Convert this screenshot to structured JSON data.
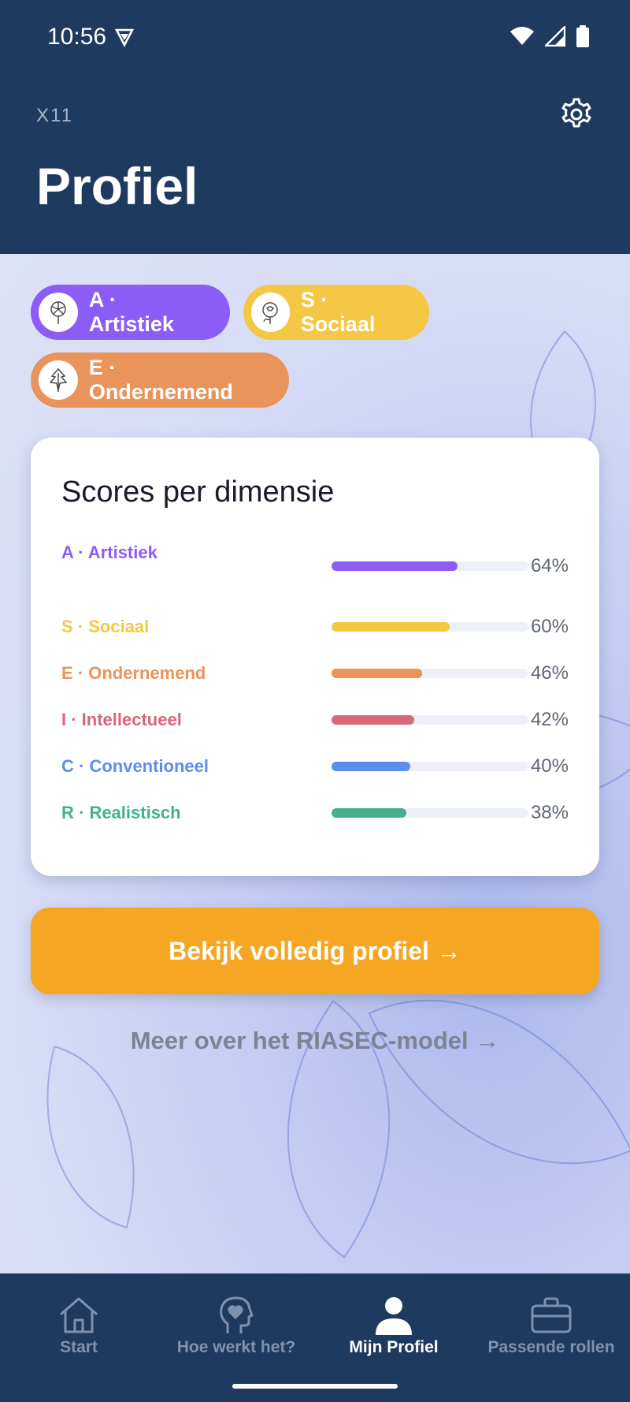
{
  "status_bar": {
    "time": "10:56"
  },
  "header": {
    "user_code": "X11",
    "title": "Profiel"
  },
  "top_types": [
    {
      "label": "A · Artistiek",
      "color": "#8b5cf6",
      "icon": "dandelion-icon"
    },
    {
      "label": "S · Sociaal",
      "color": "#f4c745",
      "icon": "rose-icon"
    },
    {
      "label": "E · Ondernemend",
      "color": "#e8945a",
      "icon": "leaf-icon"
    }
  ],
  "scores_card": {
    "title": "Scores per dimensie",
    "rows": [
      {
        "label": "A · Artistiek",
        "percent_label": "64%",
        "value": 64,
        "color": "#8b5cf6"
      },
      {
        "label": "S · Sociaal",
        "percent_label": "60%",
        "value": 60,
        "color": "#f4c745"
      },
      {
        "label": "E · Ondernemend",
        "percent_label": "46%",
        "value": 46,
        "color": "#e8945a"
      },
      {
        "label": "I · Intellectueel",
        "percent_label": "42%",
        "value": 42,
        "color": "#d9667a"
      },
      {
        "label": "C · Conventioneel",
        "percent_label": "40%",
        "value": 40,
        "color": "#5b8def"
      },
      {
        "label": "R · Realistisch",
        "percent_label": "38%",
        "value": 38,
        "color": "#45b08c"
      }
    ]
  },
  "cta": {
    "label": "Bekijk volledig profiel →"
  },
  "secondary_link": {
    "label": "Meer over het RIASEC-model →"
  },
  "bottom_nav": {
    "items": [
      {
        "label": "Start",
        "icon": "home-icon"
      },
      {
        "label": "Hoe werkt het?",
        "icon": "head-heart-icon"
      },
      {
        "label": "Mijn Profiel",
        "icon": "person-icon",
        "active": true
      },
      {
        "label": "Passende rollen",
        "icon": "briefcase-icon"
      }
    ]
  }
}
